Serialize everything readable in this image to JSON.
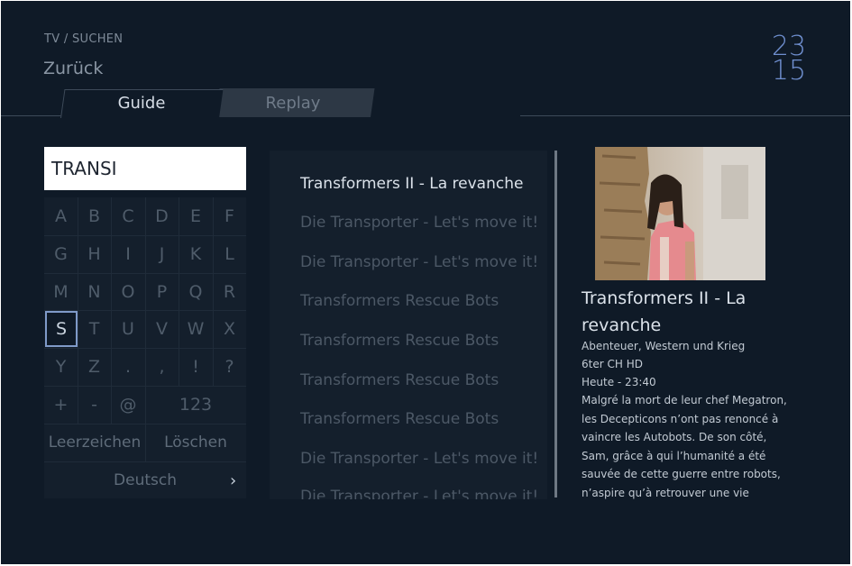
{
  "header": {
    "breadcrumb": "TV / SUCHEN",
    "back_label": "Zurück",
    "clock": {
      "hours": "23",
      "minutes": "15"
    }
  },
  "tabs": [
    {
      "label": "Guide",
      "active": true
    },
    {
      "label": "Replay",
      "active": false
    }
  ],
  "search": {
    "value": "TRANSI"
  },
  "keyboard": {
    "rows": [
      [
        "A",
        "B",
        "C",
        "D",
        "E",
        "F"
      ],
      [
        "G",
        "H",
        "I",
        "J",
        "K",
        "L"
      ],
      [
        "M",
        "N",
        "O",
        "P",
        "Q",
        "R"
      ],
      [
        "S",
        "T",
        "U",
        "V",
        "W",
        "X"
      ],
      [
        "Y",
        "Z",
        ".",
        ",",
        "!",
        "?"
      ],
      [
        "+",
        "-",
        "@",
        "123"
      ]
    ],
    "selected_key": "S",
    "space_label": "Leerzeichen",
    "delete_label": "Löschen",
    "language_label": "Deutsch",
    "language_chevron": "›"
  },
  "results": [
    "Transformers II - La revanche",
    "Die Transporter - Let's move it!",
    "Die Transporter - Let's move it!",
    "Transformers Rescue Bots",
    "Transformers Rescue Bots",
    "Transformers Rescue Bots",
    "Transformers Rescue Bots",
    "Die Transporter - Let's move it!",
    "Die Transporter - Let's move it!"
  ],
  "details": {
    "title": "Transformers II - La revanche",
    "genre": "Abenteuer, Western und Krieg",
    "channel": "6ter CH HD",
    "time": "Heute - 23:40",
    "description": "Malgré la mort de leur chef Megatron, les Decepticons n’ont pas renoncé à vaincre les Autobots. De son côté, Sam, grâce à qui l’humanité a été sauvée de cette guerre entre robots, n’aspire qu’à retrouver une vie normale. Arrivé à l"
  },
  "colors": {
    "background": "#0f1a27",
    "panel": "#141f2c",
    "accent": "#6f8fcf",
    "selected_border": "#7f9ac8"
  }
}
